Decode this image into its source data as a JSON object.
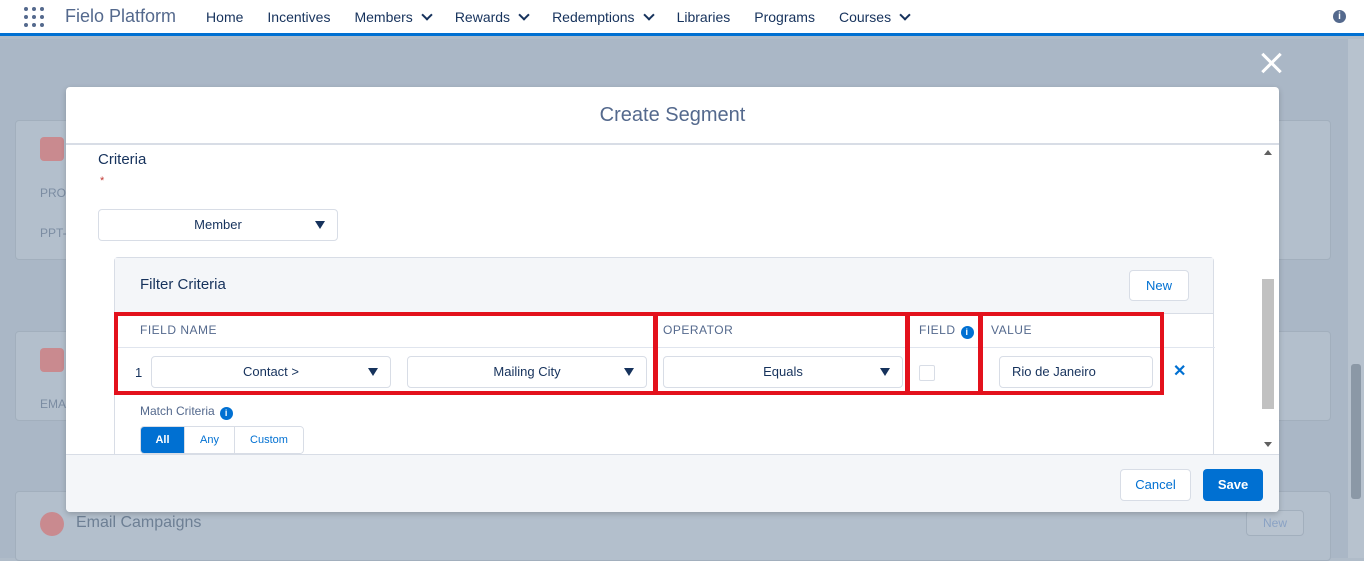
{
  "app": {
    "name": "Fielo Platform"
  },
  "nav": {
    "items": [
      {
        "label": "Home",
        "has_menu": false
      },
      {
        "label": "Incentives",
        "has_menu": false
      },
      {
        "label": "Members",
        "has_menu": true
      },
      {
        "label": "Rewards",
        "has_menu": true
      },
      {
        "label": "Redemptions",
        "has_menu": true
      },
      {
        "label": "Libraries",
        "has_menu": false
      },
      {
        "label": "Programs",
        "has_menu": false
      },
      {
        "label": "Courses",
        "has_menu": true
      }
    ],
    "info_icon": "i"
  },
  "background": {
    "row_label_1": "PRO",
    "row_label_2": "PPT-",
    "row_label_3": "EMA",
    "card_title": "Email Campaigns",
    "new_label": "New"
  },
  "modal": {
    "title": "Create Segment",
    "criteria_title": "Criteria",
    "required_mark": "*",
    "object_select": "Member",
    "filter": {
      "title": "Filter Criteria",
      "new_button": "New",
      "columns": {
        "field_name": "FIELD NAME",
        "operator": "OPERATOR",
        "field": "FIELD",
        "value": "VALUE"
      },
      "field_info_icon": "i",
      "row": {
        "number": "1",
        "field_select_1": "Contact >",
        "field_select_2": "Mailing City",
        "operator_select": "Equals",
        "field_checked": false,
        "value": "Rio de Janeiro",
        "remove": "✕"
      },
      "match_criteria_label": "Match Criteria",
      "match_info_icon": "i",
      "match_options": [
        "All",
        "Any",
        "Custom"
      ],
      "match_selected": "All"
    },
    "footer": {
      "cancel": "Cancel",
      "save": "Save"
    }
  },
  "colors": {
    "brand": "#0070d2",
    "highlight": "#e3111c",
    "text": "#16325c"
  }
}
